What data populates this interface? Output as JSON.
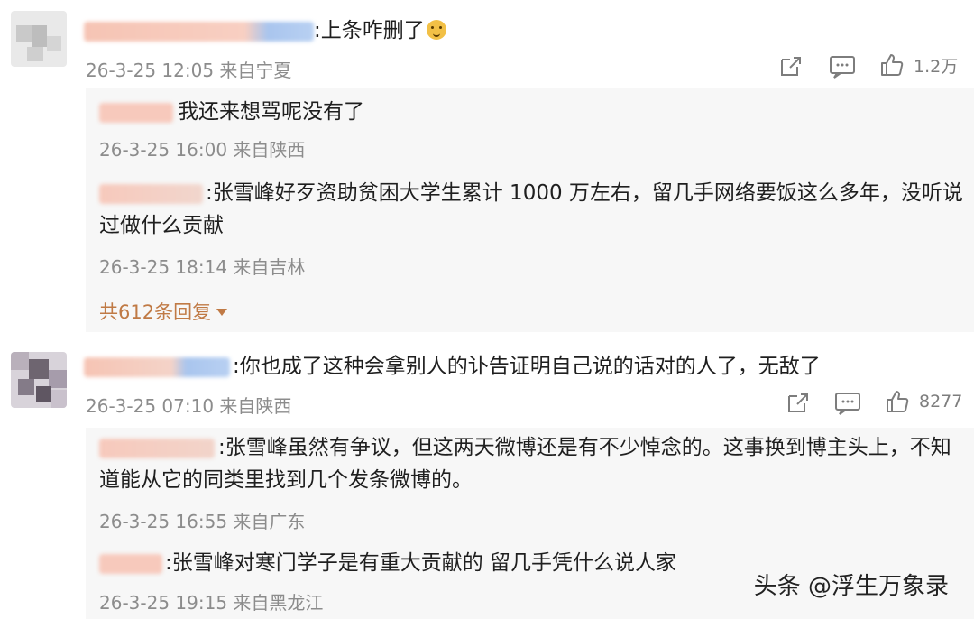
{
  "comments": [
    {
      "text": ":上条咋删了",
      "meta": "26-3-25 12:05 来自宁夏",
      "like_count": "1.2万",
      "replies": [
        {
          "text": "我还来想骂呢没有了",
          "meta": "26-3-25 16:00 来自陕西"
        },
        {
          "text": ":张雪峰好歹资助贫困大学生累计 1000 万左右，留几手网络要饭这么多年，没听说过做什么贡献",
          "meta": "26-3-25 18:14 来自吉林"
        }
      ],
      "more_replies": "共612条回复"
    },
    {
      "text": ":你也成了这种会拿别人的讣告证明自己说的话对的人了，无敌了",
      "meta": "26-3-25 07:10 来自陕西",
      "like_count": "8277",
      "replies": [
        {
          "text": ":张雪峰虽然有争议，但这两天微博还是有不少悼念的。这事换到博主头上，不知道能从它的同类里找到几个发条微博的。",
          "meta": "26-3-25 16:55 来自广东"
        },
        {
          "text": ":张雪峰对寒门学子是有重大贡献的 留几手凭什么说人家",
          "meta": "26-3-25 19:15 来自黑龙江"
        }
      ]
    }
  ],
  "watermark": "头条 @浮生万象录",
  "icons": [
    "share-icon",
    "comment-icon",
    "like-icon",
    "triangle-down-icon"
  ]
}
